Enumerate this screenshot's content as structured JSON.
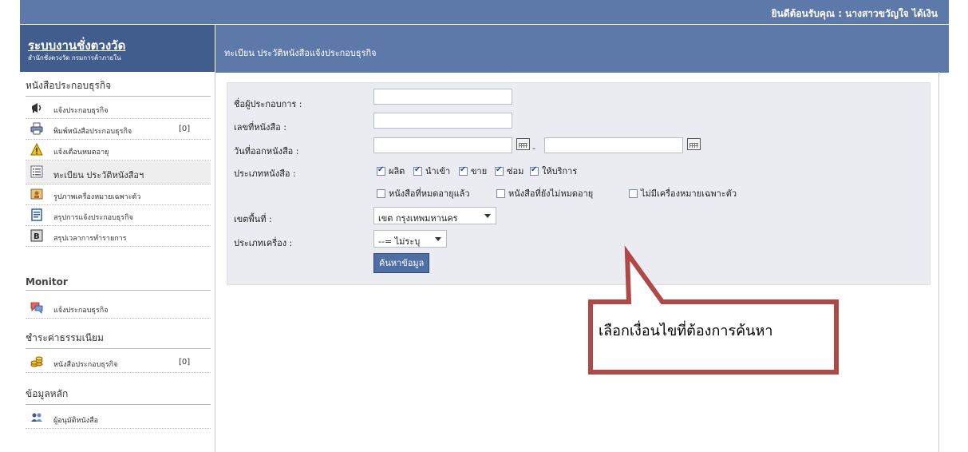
{
  "header": {
    "welcome": "ยินดีต้อนรับคุณ : นางสาวขวัญใจ ได้เงิน",
    "logo_title": "ระบบงานชั่งตวงวัด",
    "logo_subtitle": "สำนักชั่งตวงวัด กรมการค้าภายใน",
    "page_title": "ทะเบียน ประวัติหนังสือแจ้งประกอบธุรกิจ"
  },
  "sidebar": {
    "sections": [
      {
        "title": "หนังสือประกอบธุรกิจ",
        "items": [
          {
            "label": "แจ้งประกอบธุรกิจ",
            "icon": "megaphone-icon"
          },
          {
            "label": "พิมพ์หนังสือประกอบธุรกิจ",
            "count": "[0]",
            "icon": "printer-icon"
          },
          {
            "label": "แจ้งเตือนหมดอายุ",
            "icon": "warning-icon"
          },
          {
            "label": "ทะเบียน ประวัติหนังสือฯ",
            "icon": "list-icon"
          },
          {
            "label": "รูปภาพเครื่องหมายเฉพาะตัว",
            "icon": "picture-icon"
          },
          {
            "label": "สรุปการแจ้งประกอบธุรกิจ",
            "icon": "document-icon"
          },
          {
            "label": "สรุปเวลาการทำรายการ",
            "icon": "report-icon"
          }
        ]
      },
      {
        "title": "Monitor",
        "items": [
          {
            "label": "แจ้งประกอบธุรกิจ",
            "icon": "chat-icon"
          }
        ]
      },
      {
        "title": "ชำระค่าธรรมเนียม",
        "items": [
          {
            "label": "หนังสือประกอบธุรกิจ",
            "count": "[0]",
            "icon": "coins-icon"
          }
        ]
      },
      {
        "title": "ข้อมูลหลัก",
        "items": [
          {
            "label": "ผู้อนุมัติหนังสือ",
            "icon": "users-icon"
          }
        ]
      }
    ]
  },
  "form": {
    "operator_label": "ชื่อผู้ประกอบการ :",
    "operator_value": "",
    "doc_no_label": "เลขที่หนังสือ :",
    "doc_no_value": "",
    "issue_date_label": "วันที่ออกหนังสือ :",
    "date_separator": "-",
    "type_label": "ประเภทหนังสือ :",
    "type_options": [
      {
        "label": "ผลิต",
        "checked": true
      },
      {
        "label": "นำเข้า",
        "checked": true
      },
      {
        "label": "ขาย",
        "checked": true
      },
      {
        "label": "ซ่อม",
        "checked": true
      },
      {
        "label": "ให้บริการ",
        "checked": true
      }
    ],
    "status_options": [
      {
        "label": "หนังสือที่หมดอายุแล้ว",
        "checked": false
      },
      {
        "label": "หนังสือที่ยังไม่หมดอายุ",
        "checked": false
      },
      {
        "label": "ไม่มีเครื่องหมายเฉพาะตัว",
        "checked": false
      }
    ],
    "area_label": "เขตพื้นที่ :",
    "area_value": "เขต กรุงเทพมหานคร",
    "machine_label": "ประเภทเครื่อง :",
    "machine_value": "--= ไม่ระบุ",
    "search_button": "ค้นหาข้อมูล"
  },
  "callout": {
    "text": "เลือกเงื่อนไขที่ต้องการค้นหา",
    "color": "#b04848"
  }
}
